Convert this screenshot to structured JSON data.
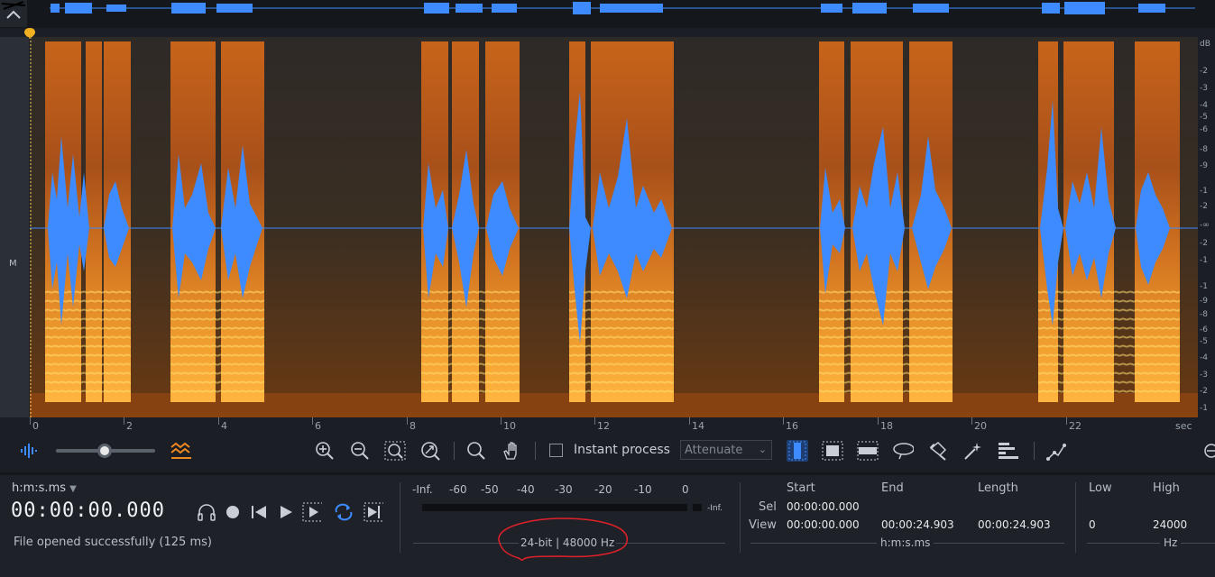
{
  "colors": {
    "waveform": "#3d8bff",
    "playhead": "#f0b020",
    "accent": "#3d8bff",
    "annotation": "#e0202a"
  },
  "track": {
    "channel_label": "M"
  },
  "ruler": {
    "db_labels": [
      "dB",
      "-2",
      "-3",
      "-4",
      "-5",
      "-6",
      "-8",
      "-9",
      "-1",
      "-2",
      "-∞",
      "-2",
      "-1",
      "-1",
      "-9",
      "-8",
      "-6",
      "-5",
      "-4",
      "-3",
      "-2",
      "-1"
    ],
    "time_labels": [
      "0",
      "2",
      "4",
      "6",
      "8",
      "10",
      "12",
      "14",
      "16",
      "18",
      "20",
      "22"
    ],
    "time_unit": "sec"
  },
  "toolbar": {
    "instant_process_label": "Instant process",
    "attenuate_value": "Attenuate",
    "icons": [
      "waveform-toggle-icon",
      "spectrogram-toggle-icon",
      "zoom-in-icon",
      "zoom-out-icon",
      "zoom-selection-icon",
      "zoom-fit-icon",
      "magnify-icon",
      "hand-icon",
      "time-select-icon",
      "time-frequency-select-icon",
      "frequency-select-icon",
      "lasso-icon",
      "brush-icon",
      "magic-wand-icon",
      "harmonic-select-icon",
      "pointer-icon"
    ]
  },
  "transport": {
    "time_format": "h:m:s.ms",
    "time_display": "00:00:00.000",
    "status": "File opened successfully (125 ms)",
    "icons": [
      "headphones-icon",
      "record-icon",
      "skip-to-start-icon",
      "play-icon",
      "play-selection-icon",
      "loop-icon",
      "skip-to-end-icon"
    ]
  },
  "meter": {
    "labels": [
      "-Inf.",
      "-60",
      "-50",
      "-40",
      "-30",
      "-20",
      "-10",
      "0"
    ],
    "right_label": "-Inf.",
    "format": "24-bit | 48000 Hz"
  },
  "selection": {
    "headers": {
      "start": "Start",
      "end": "End",
      "length": "Length",
      "low": "Low",
      "high": "High"
    },
    "rows": [
      {
        "label": "Sel",
        "start": "00:00:00.000",
        "end": "",
        "length": ""
      },
      {
        "label": "View",
        "start": "00:00:00.000",
        "end": "00:00:24.903",
        "length": "00:00:24.903"
      }
    ],
    "low": "0",
    "high": "24000",
    "time_unit": "h:m:s.ms",
    "freq_unit": "Hz"
  }
}
